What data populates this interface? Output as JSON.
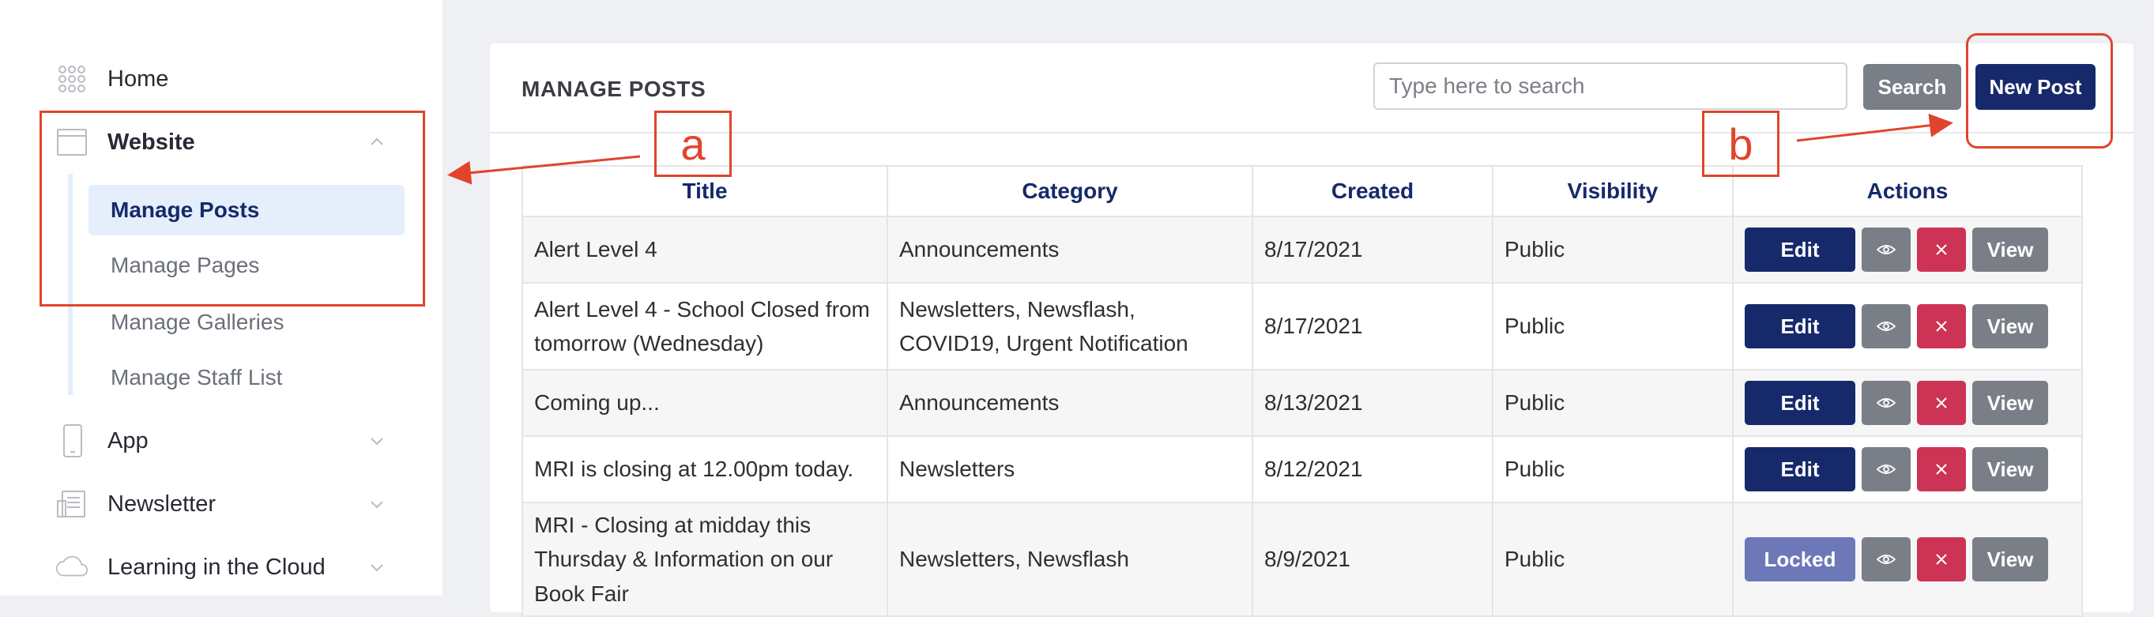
{
  "sidebar": {
    "home": "Home",
    "website": "Website",
    "sub_items": [
      "Manage Posts",
      "Manage Pages",
      "Manage Galleries",
      "Manage Staff List"
    ],
    "app": "App",
    "newsletter": "Newsletter",
    "learning": "Learning in the Cloud"
  },
  "main": {
    "title": "MANAGE POSTS",
    "search_placeholder": "Type here to search",
    "search_button": "Search",
    "new_post_button": "New Post"
  },
  "table": {
    "headers": [
      "Title",
      "Category",
      "Created",
      "Visibility",
      "Actions"
    ],
    "rows": [
      {
        "title": "Alert Level 4",
        "category": "Announcements",
        "created": "8/17/2021",
        "visibility": "Public",
        "edit": "Edit",
        "view": "View"
      },
      {
        "title": "Alert Level 4 - School Closed from tomorrow (Wednesday)",
        "category": "Newsletters, Newsflash, COVID19, Urgent Notification",
        "created": "8/17/2021",
        "visibility": "Public",
        "edit": "Edit",
        "view": "View"
      },
      {
        "title": "Coming up...",
        "category": "Announcements",
        "created": "8/13/2021",
        "visibility": "Public",
        "edit": "Edit",
        "view": "View"
      },
      {
        "title": "MRI is closing at 12.00pm today.",
        "category": "Newsletters",
        "created": "8/12/2021",
        "visibility": "Public",
        "edit": "Edit",
        "view": "View"
      },
      {
        "title": "MRI - Closing at midday this Thursday & Information on our Book Fair",
        "category": "Newsletters, Newsflash",
        "created": "8/9/2021",
        "visibility": "Public",
        "edit": "Locked",
        "view": "View"
      }
    ]
  },
  "annotations": {
    "a": "a",
    "b": "b",
    "color": "#e0452c"
  },
  "colors": {
    "primary": "#16296b",
    "secondary": "#7a7f87",
    "danger": "#cc3355",
    "locked": "#6c78b8"
  }
}
